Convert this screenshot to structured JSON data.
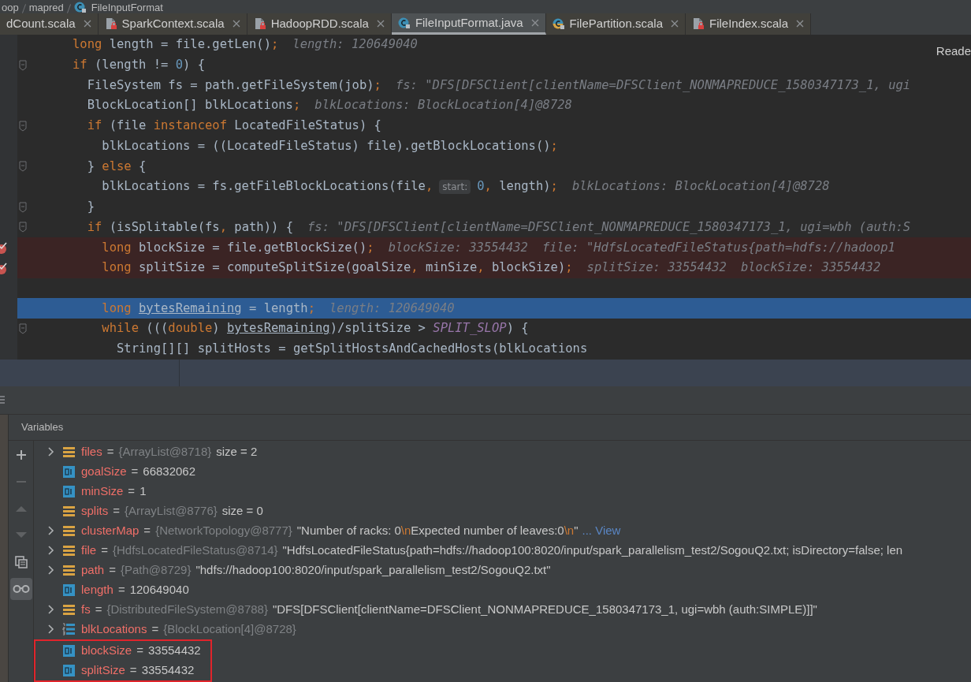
{
  "breadcrumb": {
    "items": [
      {
        "label": "oop",
        "kind": "folder"
      },
      {
        "label": "mapred",
        "kind": "folder"
      },
      {
        "label": "FileInputFormat",
        "kind": "java-class"
      }
    ]
  },
  "tabs": [
    {
      "label": "dCount.scala",
      "kind": "cut",
      "selected": false
    },
    {
      "label": "SparkContext.scala",
      "kind": "scala-file",
      "selected": false
    },
    {
      "label": "HadoopRDD.scala",
      "kind": "scala-file",
      "selected": false
    },
    {
      "label": "FileInputFormat.java",
      "kind": "java-class",
      "selected": true
    },
    {
      "label": "FilePartition.scala",
      "kind": "scala-class",
      "selected": false
    },
    {
      "label": "FileIndex.scala",
      "kind": "scala-file",
      "selected": false
    }
  ],
  "editor": {
    "reader_mode": "Reade",
    "lines": [
      {
        "kind": "plain",
        "fold": false,
        "tokens": [
          {
            "t": "      long",
            "kind": "kw"
          },
          {
            "t": " length = file.getLen()",
            "kind": "tx"
          },
          {
            "t": ";",
            "kind": "op"
          },
          {
            "t": "length: 120649040",
            "kind": "hint"
          }
        ]
      },
      {
        "kind": "plain",
        "fold": true,
        "tokens": [
          {
            "t": "      if",
            "kind": "kw"
          },
          {
            "t": " (length != ",
            "kind": "tx"
          },
          {
            "t": "0",
            "kind": "num"
          },
          {
            "t": ") {",
            "kind": "tx"
          }
        ]
      },
      {
        "kind": "plain",
        "fold": false,
        "tokens": [
          {
            "t": "        FileSystem fs = path.getFileSystem(job)",
            "kind": "tx"
          },
          {
            "t": ";",
            "kind": "op"
          },
          {
            "t": "fs: \"DFS[DFSClient[clientName=DFSClient_NONMAPREDUCE_1580347173_1, ugi",
            "kind": "hint"
          }
        ]
      },
      {
        "kind": "plain",
        "fold": false,
        "tokens": [
          {
            "t": "        BlockLocation[] blkLocations",
            "kind": "tx"
          },
          {
            "t": ";",
            "kind": "op"
          },
          {
            "t": "blkLocations: BlockLocation[4]@8728",
            "kind": "hint"
          }
        ]
      },
      {
        "kind": "plain",
        "fold": true,
        "tokens": [
          {
            "t": "        if",
            "kind": "kw"
          },
          {
            "t": " (file ",
            "kind": "tx"
          },
          {
            "t": "instanceof",
            "kind": "kw"
          },
          {
            "t": " LocatedFileStatus) {",
            "kind": "tx"
          }
        ]
      },
      {
        "kind": "plain",
        "fold": false,
        "tokens": [
          {
            "t": "          blkLocations = ((LocatedFileStatus) file).getBlockLocations()",
            "kind": "tx"
          },
          {
            "t": ";",
            "kind": "op"
          }
        ]
      },
      {
        "kind": "plain",
        "fold": true,
        "tokens": [
          {
            "t": "        } ",
            "kind": "tx"
          },
          {
            "t": "else",
            "kind": "kw"
          },
          {
            "t": " {",
            "kind": "tx"
          }
        ]
      },
      {
        "kind": "plain",
        "fold": false,
        "tokens": [
          {
            "t": "          blkLocations = fs.getFileBlockLocations(file",
            "kind": "tx"
          },
          {
            "t": ",",
            "kind": "op"
          },
          {
            "t": "start:",
            "kind": "chip"
          },
          {
            "t": "0",
            "kind": "num"
          },
          {
            "t": ",",
            "kind": "op"
          },
          {
            "t": " length)",
            "kind": "tx"
          },
          {
            "t": ";",
            "kind": "op"
          },
          {
            "t": "blkLocations: BlockLocation[4]@8728",
            "kind": "hint"
          }
        ]
      },
      {
        "kind": "plain",
        "fold": true,
        "tokens": [
          {
            "t": "        }",
            "kind": "tx"
          }
        ]
      },
      {
        "kind": "plain",
        "fold": true,
        "tokens": [
          {
            "t": "        if",
            "kind": "kw"
          },
          {
            "t": " (isSplitable(fs",
            "kind": "tx"
          },
          {
            "t": ",",
            "kind": "op"
          },
          {
            "t": " path)) {",
            "kind": "tx"
          },
          {
            "t": "fs: \"DFS[DFSClient[clientName=DFSClient_NONMAPREDUCE_1580347173_1, ugi=wbh (auth:S",
            "kind": "hint"
          }
        ]
      },
      {
        "kind": "breakpoint",
        "fold": false,
        "tokens": [
          {
            "t": "          long",
            "kind": "kw"
          },
          {
            "t": " blockSize = file.getBlockSize()",
            "kind": "tx"
          },
          {
            "t": ";",
            "kind": "op"
          },
          {
            "t": "blockSize: 33554432",
            "kind": "hint"
          },
          {
            "t": "file: \"HdfsLocatedFileStatus{path=hdfs://hadoop1",
            "kind": "hint"
          }
        ]
      },
      {
        "kind": "breakpoint",
        "fold": false,
        "tokens": [
          {
            "t": "          long",
            "kind": "kw"
          },
          {
            "t": " splitSize = computeSplitSize(goalSize",
            "kind": "tx"
          },
          {
            "t": ",",
            "kind": "op"
          },
          {
            "t": " minSize",
            "kind": "tx"
          },
          {
            "t": ",",
            "kind": "op"
          },
          {
            "t": " blockSize)",
            "kind": "tx"
          },
          {
            "t": ";",
            "kind": "op"
          },
          {
            "t": "splitSize: 33554432",
            "kind": "hint"
          },
          {
            "t": "blockSize: 33554432",
            "kind": "hint"
          }
        ]
      },
      {
        "kind": "plain",
        "fold": false
      },
      {
        "kind": "current",
        "fold": false,
        "tokens": [
          {
            "t": "          long ",
            "kind": "kw"
          },
          {
            "t": "bytesRemaining",
            "kind": "ul"
          },
          {
            "t": " = length",
            "kind": "tx"
          },
          {
            "t": ";",
            "kind": "op"
          },
          {
            "t": "length: 120649040",
            "kind": "hint"
          }
        ]
      },
      {
        "kind": "plain",
        "fold": true,
        "tokens": [
          {
            "t": "          while",
            "kind": "kw"
          },
          {
            "t": " (((",
            "kind": "tx"
          },
          {
            "t": "double",
            "kind": "kw"
          },
          {
            "t": ") ",
            "kind": "tx"
          },
          {
            "t": "bytesRemaining",
            "kind": "ul"
          },
          {
            "t": ")/splitSize > ",
            "kind": "tx"
          },
          {
            "t": "SPLIT_SLOP",
            "kind": "const"
          },
          {
            "t": ") {",
            "kind": "tx"
          }
        ]
      },
      {
        "kind": "plain",
        "fold": false,
        "tokens": [
          {
            "t": "            String[][] splitHosts = getSplitHostsAndCachedHosts(blkLocations",
            "kind": "tx"
          }
        ]
      }
    ]
  },
  "debugger": {
    "title": "Variables",
    "toolbar": [
      {
        "kind": "add",
        "disabled": false,
        "selected": false
      },
      {
        "kind": "remove",
        "disabled": true,
        "selected": false
      },
      {
        "kind": "up",
        "disabled": true,
        "selected": false
      },
      {
        "kind": "down",
        "disabled": true,
        "selected": false
      },
      {
        "kind": "copy",
        "disabled": false,
        "selected": false
      },
      {
        "kind": "watch",
        "disabled": false,
        "selected": true
      }
    ],
    "variables": [
      {
        "name": "files",
        "sep": "=",
        "expandable": true,
        "kind": "object",
        "highlighted": false,
        "type": "{ArrayList@8718}",
        "value": [
          {
            "t": "size = 2",
            "kind": "plain"
          }
        ]
      },
      {
        "name": "goalSize",
        "sep": "=",
        "expandable": false,
        "kind": "primitive",
        "highlighted": false,
        "value": [
          {
            "t": "66832062",
            "kind": "plain"
          }
        ]
      },
      {
        "name": "minSize",
        "sep": "=",
        "expandable": false,
        "kind": "primitive",
        "highlighted": false,
        "value": [
          {
            "t": "1",
            "kind": "plain"
          }
        ]
      },
      {
        "name": "splits",
        "sep": "=",
        "expandable": false,
        "kind": "object",
        "highlighted": false,
        "type": "{ArrayList@8776}",
        "value": [
          {
            "t": "size = 0",
            "kind": "plain"
          }
        ]
      },
      {
        "name": "clusterMap",
        "sep": "=",
        "expandable": true,
        "kind": "object",
        "highlighted": false,
        "type": "{NetworkTopology@8777}",
        "value": [
          {
            "t": "\"Number of racks: 0",
            "kind": "plain"
          },
          {
            "t": "\\n",
            "kind": "esc"
          },
          {
            "t": "Expected number of leaves:0",
            "kind": "plain"
          },
          {
            "t": "\\n",
            "kind": "esc"
          },
          {
            "t": "\"",
            "kind": "plain"
          }
        ],
        "link": "... View"
      },
      {
        "name": "file",
        "sep": "=",
        "expandable": true,
        "kind": "object",
        "highlighted": false,
        "type": "{HdfsLocatedFileStatus@8714}",
        "value": [
          {
            "t": "\"HdfsLocatedFileStatus{path=hdfs://hadoop100:8020/input/spark_parallelism_test2/SogouQ2.txt; isDirectory=false; len",
            "kind": "plain"
          }
        ]
      },
      {
        "name": "path",
        "sep": "=",
        "expandable": true,
        "kind": "object",
        "highlighted": false,
        "type": "{Path@8729}",
        "value": [
          {
            "t": "\"hdfs://hadoop100:8020/input/spark_parallelism_test2/SogouQ2.txt\"",
            "kind": "plain"
          }
        ]
      },
      {
        "name": "length",
        "sep": "=",
        "expandable": false,
        "kind": "primitive",
        "highlighted": false,
        "value": [
          {
            "t": "120649040",
            "kind": "plain"
          }
        ]
      },
      {
        "name": "fs",
        "sep": "=",
        "expandable": true,
        "kind": "object",
        "highlighted": false,
        "type": "{DistributedFileSystem@8788}",
        "value": [
          {
            "t": "\"DFS[DFSClient[clientName=DFSClient_NONMAPREDUCE_1580347173_1, ugi=wbh (auth:SIMPLE)]]\"",
            "kind": "plain"
          }
        ]
      },
      {
        "name": "blkLocations",
        "sep": "=",
        "expandable": true,
        "kind": "array",
        "highlighted": false,
        "type": "{BlockLocation[4]@8728}"
      },
      {
        "name": "blockSize",
        "sep": "=",
        "expandable": false,
        "kind": "primitive",
        "highlighted": true,
        "value": [
          {
            "t": "33554432",
            "kind": "plain"
          }
        ]
      },
      {
        "name": "splitSize",
        "sep": "=",
        "expandable": false,
        "kind": "primitive",
        "highlighted": true,
        "value": [
          {
            "t": "33554432",
            "kind": "plain"
          }
        ]
      }
    ]
  }
}
